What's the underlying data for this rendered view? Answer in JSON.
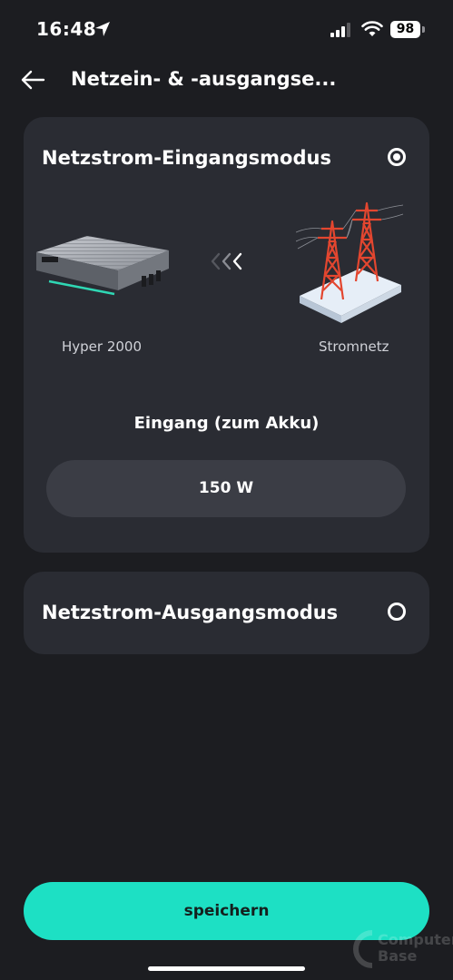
{
  "status_bar": {
    "time": "16:48",
    "battery": "98"
  },
  "header": {
    "title": "Netzein- & -ausgangse..."
  },
  "input_mode": {
    "title": "Netzstrom-Eingangsmodus",
    "selected": true,
    "device_label": "Hyper 2000",
    "grid_label": "Stromnetz",
    "input_heading": "Eingang (zum Akku)",
    "power_value": "150 W"
  },
  "output_mode": {
    "title": "Netzstrom-Ausgangsmodus",
    "selected": false
  },
  "save_label": "speichern",
  "watermark": {
    "line1": "Computer",
    "line2": "Base"
  },
  "icons": {
    "location": "location-arrow-icon",
    "signal": "cellular-signal-icon",
    "wifi": "wifi-icon",
    "back": "back-arrow-icon",
    "flow": "triple-chevron-left-icon"
  },
  "colors": {
    "background": "#1c1d21",
    "card": "#2a2c33",
    "accent": "#1de0c4"
  }
}
